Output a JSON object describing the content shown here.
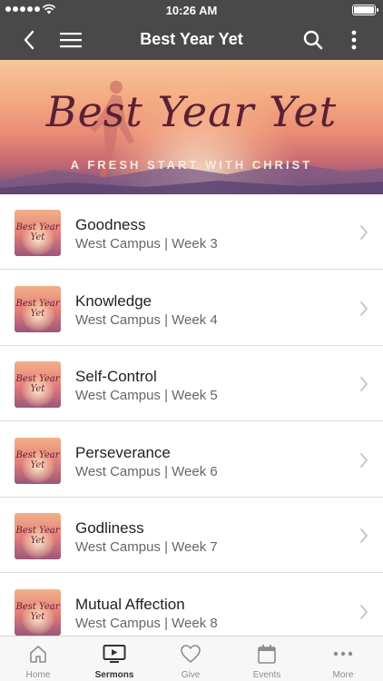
{
  "status_bar": {
    "time": "10:26 AM"
  },
  "nav": {
    "title": "Best Year Yet"
  },
  "hero": {
    "title": "Best Year Yet",
    "subtitle": "A FRESH START WITH CHRIST"
  },
  "sermons": [
    {
      "title": "Goodness",
      "meta": "West Campus | Week 3"
    },
    {
      "title": "Knowledge",
      "meta": "West Campus | Week 4"
    },
    {
      "title": "Self-Control",
      "meta": "West Campus | Week 5"
    },
    {
      "title": "Perseverance",
      "meta": "West Campus | Week 6"
    },
    {
      "title": "Godliness",
      "meta": "West Campus | Week 7"
    },
    {
      "title": "Mutual Affection",
      "meta": "West Campus | Week 8"
    }
  ],
  "thumbnail_text": "Best Year Yet",
  "tabs": [
    {
      "label": "Home",
      "icon": "home-icon"
    },
    {
      "label": "Sermons",
      "icon": "tv-play-icon"
    },
    {
      "label": "Give",
      "icon": "heart-icon"
    },
    {
      "label": "Events",
      "icon": "calendar-icon"
    },
    {
      "label": "More",
      "icon": "more-dots-icon"
    }
  ],
  "active_tab": "Sermons",
  "colors": {
    "bar": "#494949",
    "tab_inactive": "#8c8c8c",
    "tab_active": "#333333"
  }
}
